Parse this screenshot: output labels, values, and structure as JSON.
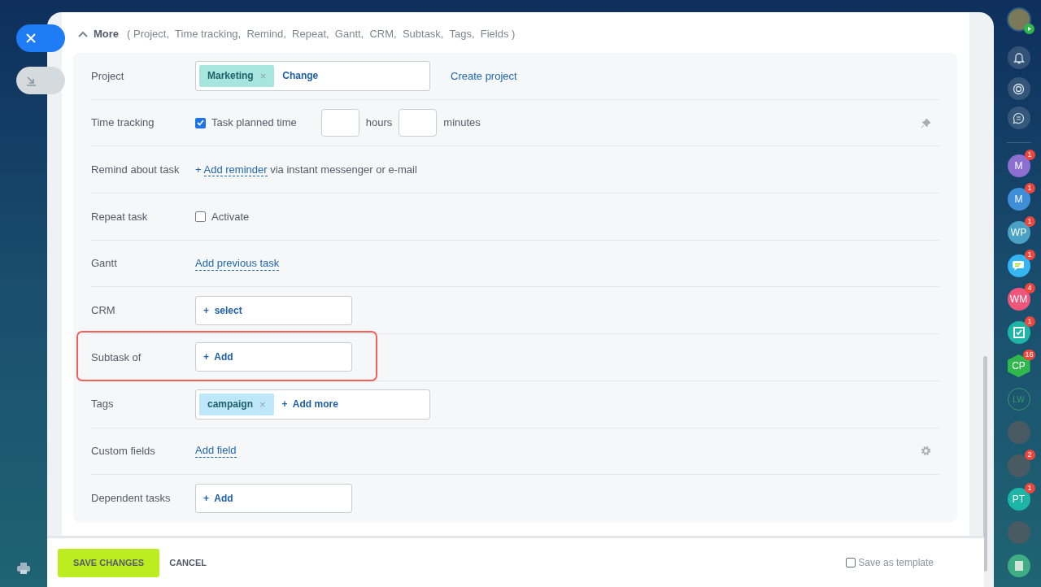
{
  "header": {
    "title": "More",
    "expanded": true,
    "sections": "( Project,  Time tracking,  Remind,  Repeat,  Gantt,  CRM,  Subtask,  Tags,  Fields )"
  },
  "rows": [
    {
      "kind": "tag_select",
      "label": "Project",
      "tag": "Marketing",
      "color": "#a7e6df",
      "remove": "×",
      "action": "Change",
      "side_link": "Create project",
      "highlighted": false
    },
    {
      "kind": "time",
      "label": "Time tracking",
      "checkbox": {
        "label": "Task planned time",
        "checked": true
      },
      "hours_unit": "hours",
      "minutes_unit": "minutes",
      "pin_button": true,
      "highlighted": false
    },
    {
      "kind": "link_text",
      "label": "Remind about task",
      "prefix": "+",
      "link": "Add reminder",
      "text": "via instant messenger or e-mail",
      "highlighted": false
    },
    {
      "kind": "checkbox",
      "label": "Repeat task",
      "checkbox": {
        "label": "Activate",
        "checked": false
      },
      "highlighted": false
    },
    {
      "kind": "link",
      "label": "Gantt",
      "link": "Add previous task",
      "highlighted": false
    },
    {
      "kind": "button",
      "label": "CRM",
      "button": "+  select",
      "highlighted": false
    },
    {
      "kind": "button",
      "label": "Subtask of",
      "button": "+  Add",
      "highlighted": true
    },
    {
      "kind": "tag_select",
      "label": "Tags",
      "tag": "campaign",
      "color": "#bfe7fb",
      "remove": "×",
      "action": "+  Add more",
      "highlighted": false
    },
    {
      "kind": "link",
      "label": "Custom fields",
      "link": "Add field",
      "settings_button": true,
      "highlighted": false
    },
    {
      "kind": "button",
      "label": "Dependent tasks",
      "button": "+  Add",
      "highlighted": false
    }
  ],
  "footer": {
    "save": "SAVE CHANGES",
    "cancel": "CANCEL",
    "template": {
      "label": "Save as template",
      "checked": false
    }
  },
  "right_sidebar": [
    {
      "kind": "initials",
      "initials": "M",
      "badge": "1",
      "color": "#8d6fd1"
    },
    {
      "kind": "initials",
      "initials": "M",
      "badge": "1",
      "color": "#3f8fd8"
    },
    {
      "kind": "initials",
      "initials": "WP",
      "badge": "1",
      "color": "#4aa2c6"
    },
    {
      "kind": "chat",
      "badge": "1",
      "color": "#35b6f2"
    },
    {
      "kind": "initials",
      "initials": "WM",
      "badge": "4",
      "color": "#f0557c"
    },
    {
      "kind": "task",
      "badge": "1",
      "color": "#1db5a6"
    },
    {
      "kind": "hexagon",
      "initials": "CP",
      "badge": "16",
      "color": "#2fb84c"
    },
    {
      "kind": "outline",
      "initials": "LW",
      "color": "#3d9a6a"
    },
    {
      "kind": "photo"
    },
    {
      "kind": "photo",
      "badge": "2"
    },
    {
      "kind": "initials",
      "initials": "PT",
      "badge": "1",
      "color": "#1db5a6"
    },
    {
      "kind": "photo"
    },
    {
      "kind": "doc",
      "color": "#3fae84"
    }
  ]
}
